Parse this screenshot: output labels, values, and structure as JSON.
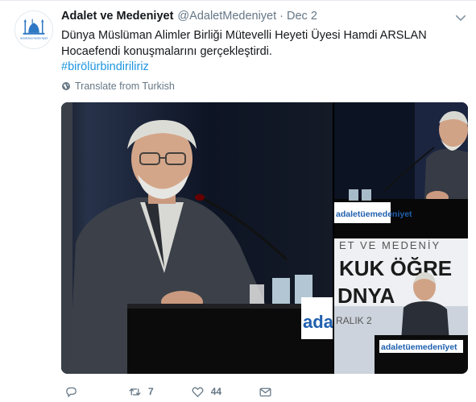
{
  "tweet": {
    "author_name": "Adalet ve Medeniyet",
    "author_handle": "@AdaletMedeniyet",
    "separator": "·",
    "date": "Dec 2",
    "text_line1": "Dünya Müslüman Alimler Birliği Mütevelli Heyeti Üyesi Hamdi ARSLAN",
    "text_line2": "Hocaefendi konuşmalarını gerçekleştirdi.",
    "hashtag": "#birölürbindiriliriz",
    "translate_label": "Translate from Turkish",
    "avatar_text": "adaletuemedeniyet"
  },
  "media": {
    "photo1_sign": "adal",
    "photo2_sign": "adaletüemedeniyet",
    "photo3_banner_lines": [
      "ET VE MEDENİY",
      "KUK ÖĞRE",
      "DNYA",
      "RALIK 2"
    ],
    "photo3_sign": "adaletüemedenīyet"
  },
  "actions": {
    "reply_icon": "reply-icon",
    "retweet_icon": "retweet-icon",
    "retweet_count": "7",
    "like_icon": "heart-icon",
    "like_count": "44",
    "dm_icon": "envelope-icon"
  },
  "colors": {
    "link": "#1b95e0",
    "secondary_text": "#657786",
    "primary_text": "#14171a",
    "brand_blue": "#1f5fae"
  }
}
